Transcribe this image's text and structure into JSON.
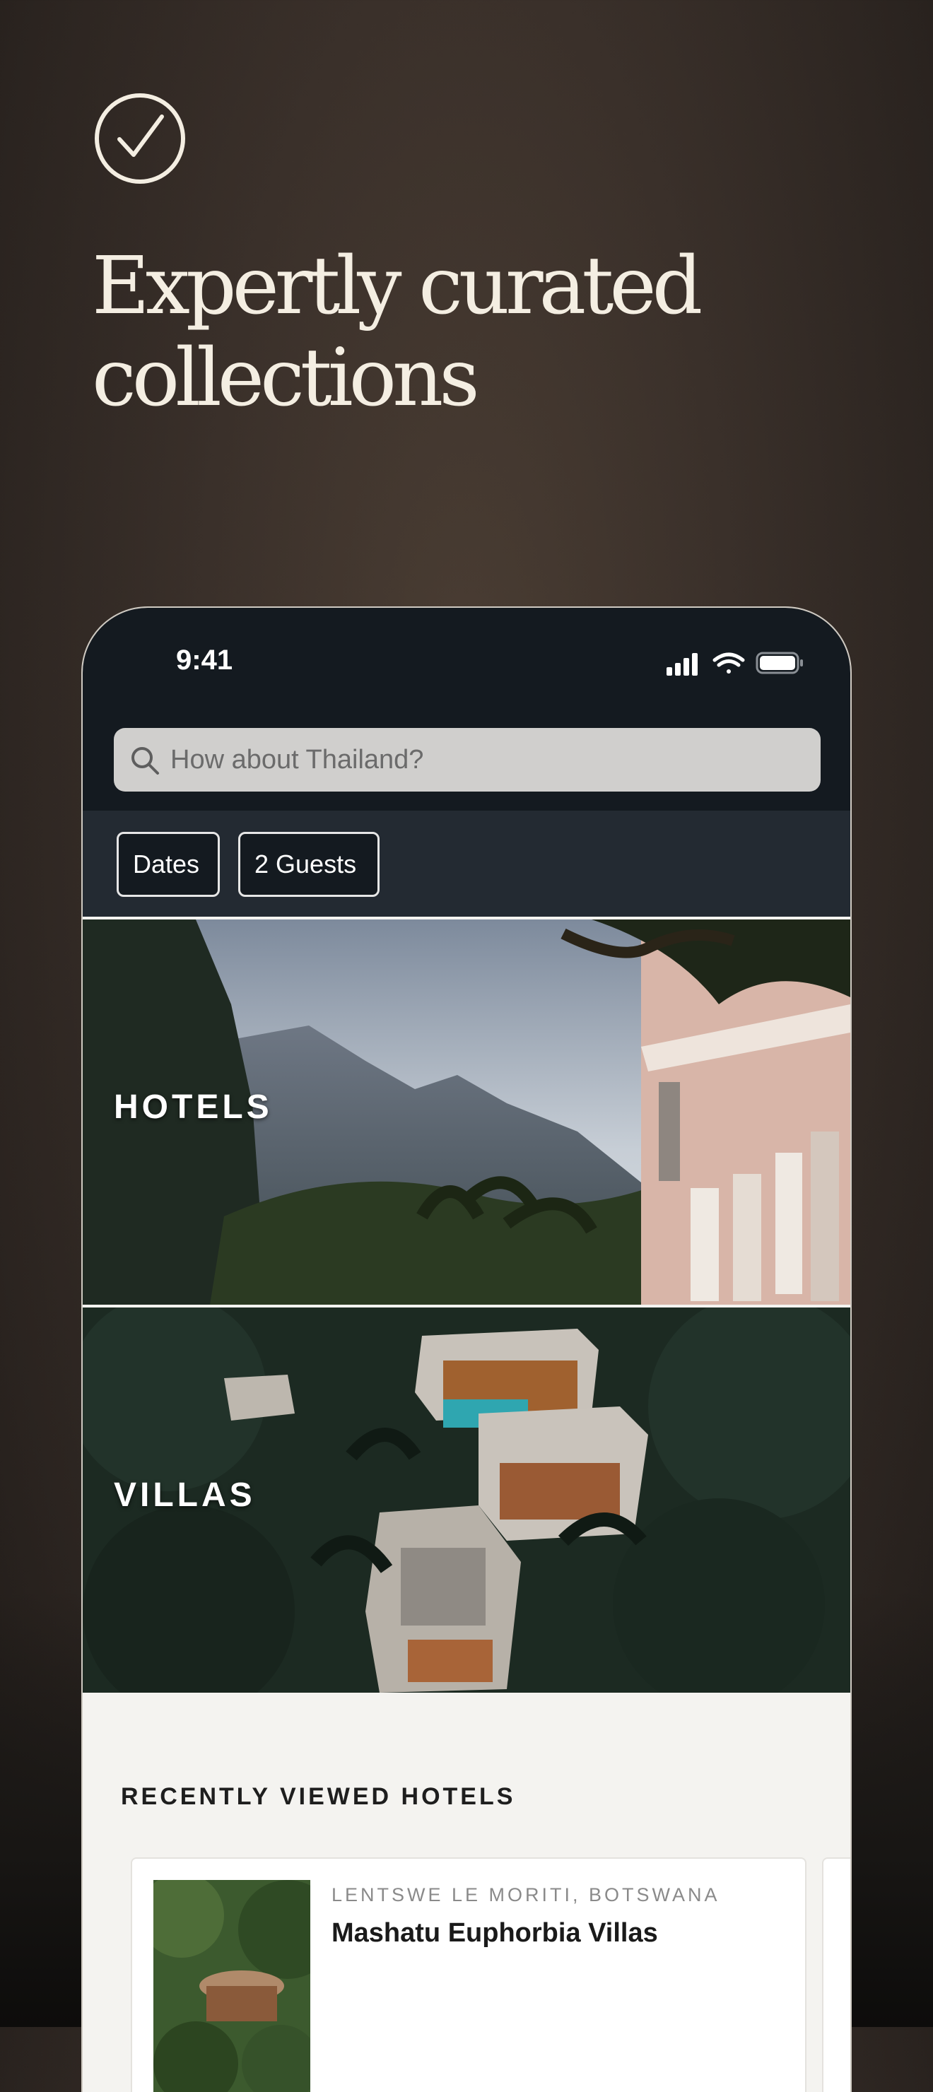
{
  "hero": {
    "headline": "Expertly curated collections",
    "icon": "check-circle-icon"
  },
  "phone": {
    "status": {
      "time": "9:41",
      "icons": [
        "signal-icon",
        "wifi-icon",
        "battery-icon"
      ]
    },
    "search": {
      "placeholder": "How about Thailand?",
      "icon": "search-icon"
    },
    "filters": [
      {
        "label": "Dates"
      },
      {
        "label": "2 Guests"
      }
    ],
    "collections": [
      {
        "label": "HOTELS"
      },
      {
        "label": "VILLAS"
      }
    ],
    "recent": {
      "title": "RECENTLY VIEWED HOTELS",
      "cards": [
        {
          "location": "LENTSWE LE MORITI, BOTSWANA",
          "name": "Mashatu Euphorbia Villas"
        }
      ]
    }
  },
  "colors": {
    "background": "#3a302a",
    "headline": "#f4eee2",
    "phone_top": "#141a20",
    "filter_bar": "#232a32"
  }
}
